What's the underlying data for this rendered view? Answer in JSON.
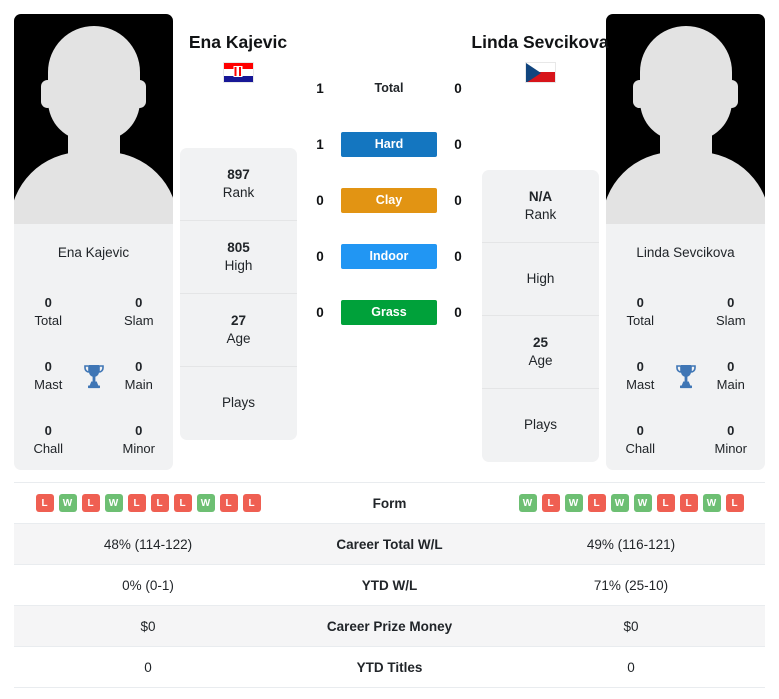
{
  "players": {
    "left": {
      "name": "Ena Kajevic",
      "flag": "croatia-flag",
      "card_name": "Ena Kajevic",
      "titles": {
        "total": "0",
        "total_label": "Total",
        "slam": "0",
        "slam_label": "Slam",
        "mast": "0",
        "mast_label": "Mast",
        "main": "0",
        "main_label": "Main",
        "chall": "0",
        "chall_label": "Chall",
        "minor": "0",
        "minor_label": "Minor"
      },
      "info": {
        "rank": "897",
        "rank_label": "Rank",
        "high": "805",
        "high_label": "High",
        "age": "27",
        "age_label": "Age",
        "plays": "",
        "plays_label": "Plays"
      }
    },
    "right": {
      "name": "Linda Sevcikova",
      "flag": "czechia-flag",
      "card_name": "Linda Sevcikova",
      "titles": {
        "total": "0",
        "total_label": "Total",
        "slam": "0",
        "slam_label": "Slam",
        "mast": "0",
        "mast_label": "Mast",
        "main": "0",
        "main_label": "Main",
        "chall": "0",
        "chall_label": "Chall",
        "minor": "0",
        "minor_label": "Minor"
      },
      "info": {
        "rank": "N/A",
        "rank_label": "Rank",
        "high": "",
        "high_label": "High",
        "age": "25",
        "age_label": "Age",
        "plays": "",
        "plays_label": "Plays"
      }
    }
  },
  "head_to_head": [
    {
      "left": "1",
      "label": "Total",
      "right": "0",
      "color": "",
      "pill": false
    },
    {
      "left": "1",
      "label": "Hard",
      "right": "0",
      "color": "#1476c0",
      "pill": true
    },
    {
      "left": "0",
      "label": "Clay",
      "right": "0",
      "color": "#e29413",
      "pill": true
    },
    {
      "left": "0",
      "label": "Indoor",
      "right": "0",
      "color": "#2196f3",
      "pill": true
    },
    {
      "left": "0",
      "label": "Grass",
      "right": "0",
      "color": "#00a13a",
      "pill": true
    }
  ],
  "stats_rows": [
    {
      "label": "Form",
      "type": "form",
      "left_form": [
        "L",
        "W",
        "L",
        "W",
        "L",
        "L",
        "L",
        "W",
        "L",
        "L"
      ],
      "right_form": [
        "W",
        "L",
        "W",
        "L",
        "W",
        "W",
        "L",
        "L",
        "W",
        "L"
      ],
      "left": "",
      "right": ""
    },
    {
      "label": "Career Total W/L",
      "type": "text",
      "left": "48% (114-122)",
      "right": "49% (116-121)"
    },
    {
      "label": "YTD W/L",
      "type": "text",
      "left": "0% (0-1)",
      "right": "71% (25-10)"
    },
    {
      "label": "Career Prize Money",
      "type": "text",
      "left": "$0",
      "right": "$0"
    },
    {
      "label": "YTD Titles",
      "type": "text",
      "left": "0",
      "right": "0"
    }
  ],
  "colors": {
    "win": "#6dbf73",
    "loss": "#ef5f52",
    "trophy": "#3f76b5",
    "card_bg": "#f1f2f3"
  },
  "icons": {
    "trophy": "trophy-icon"
  }
}
